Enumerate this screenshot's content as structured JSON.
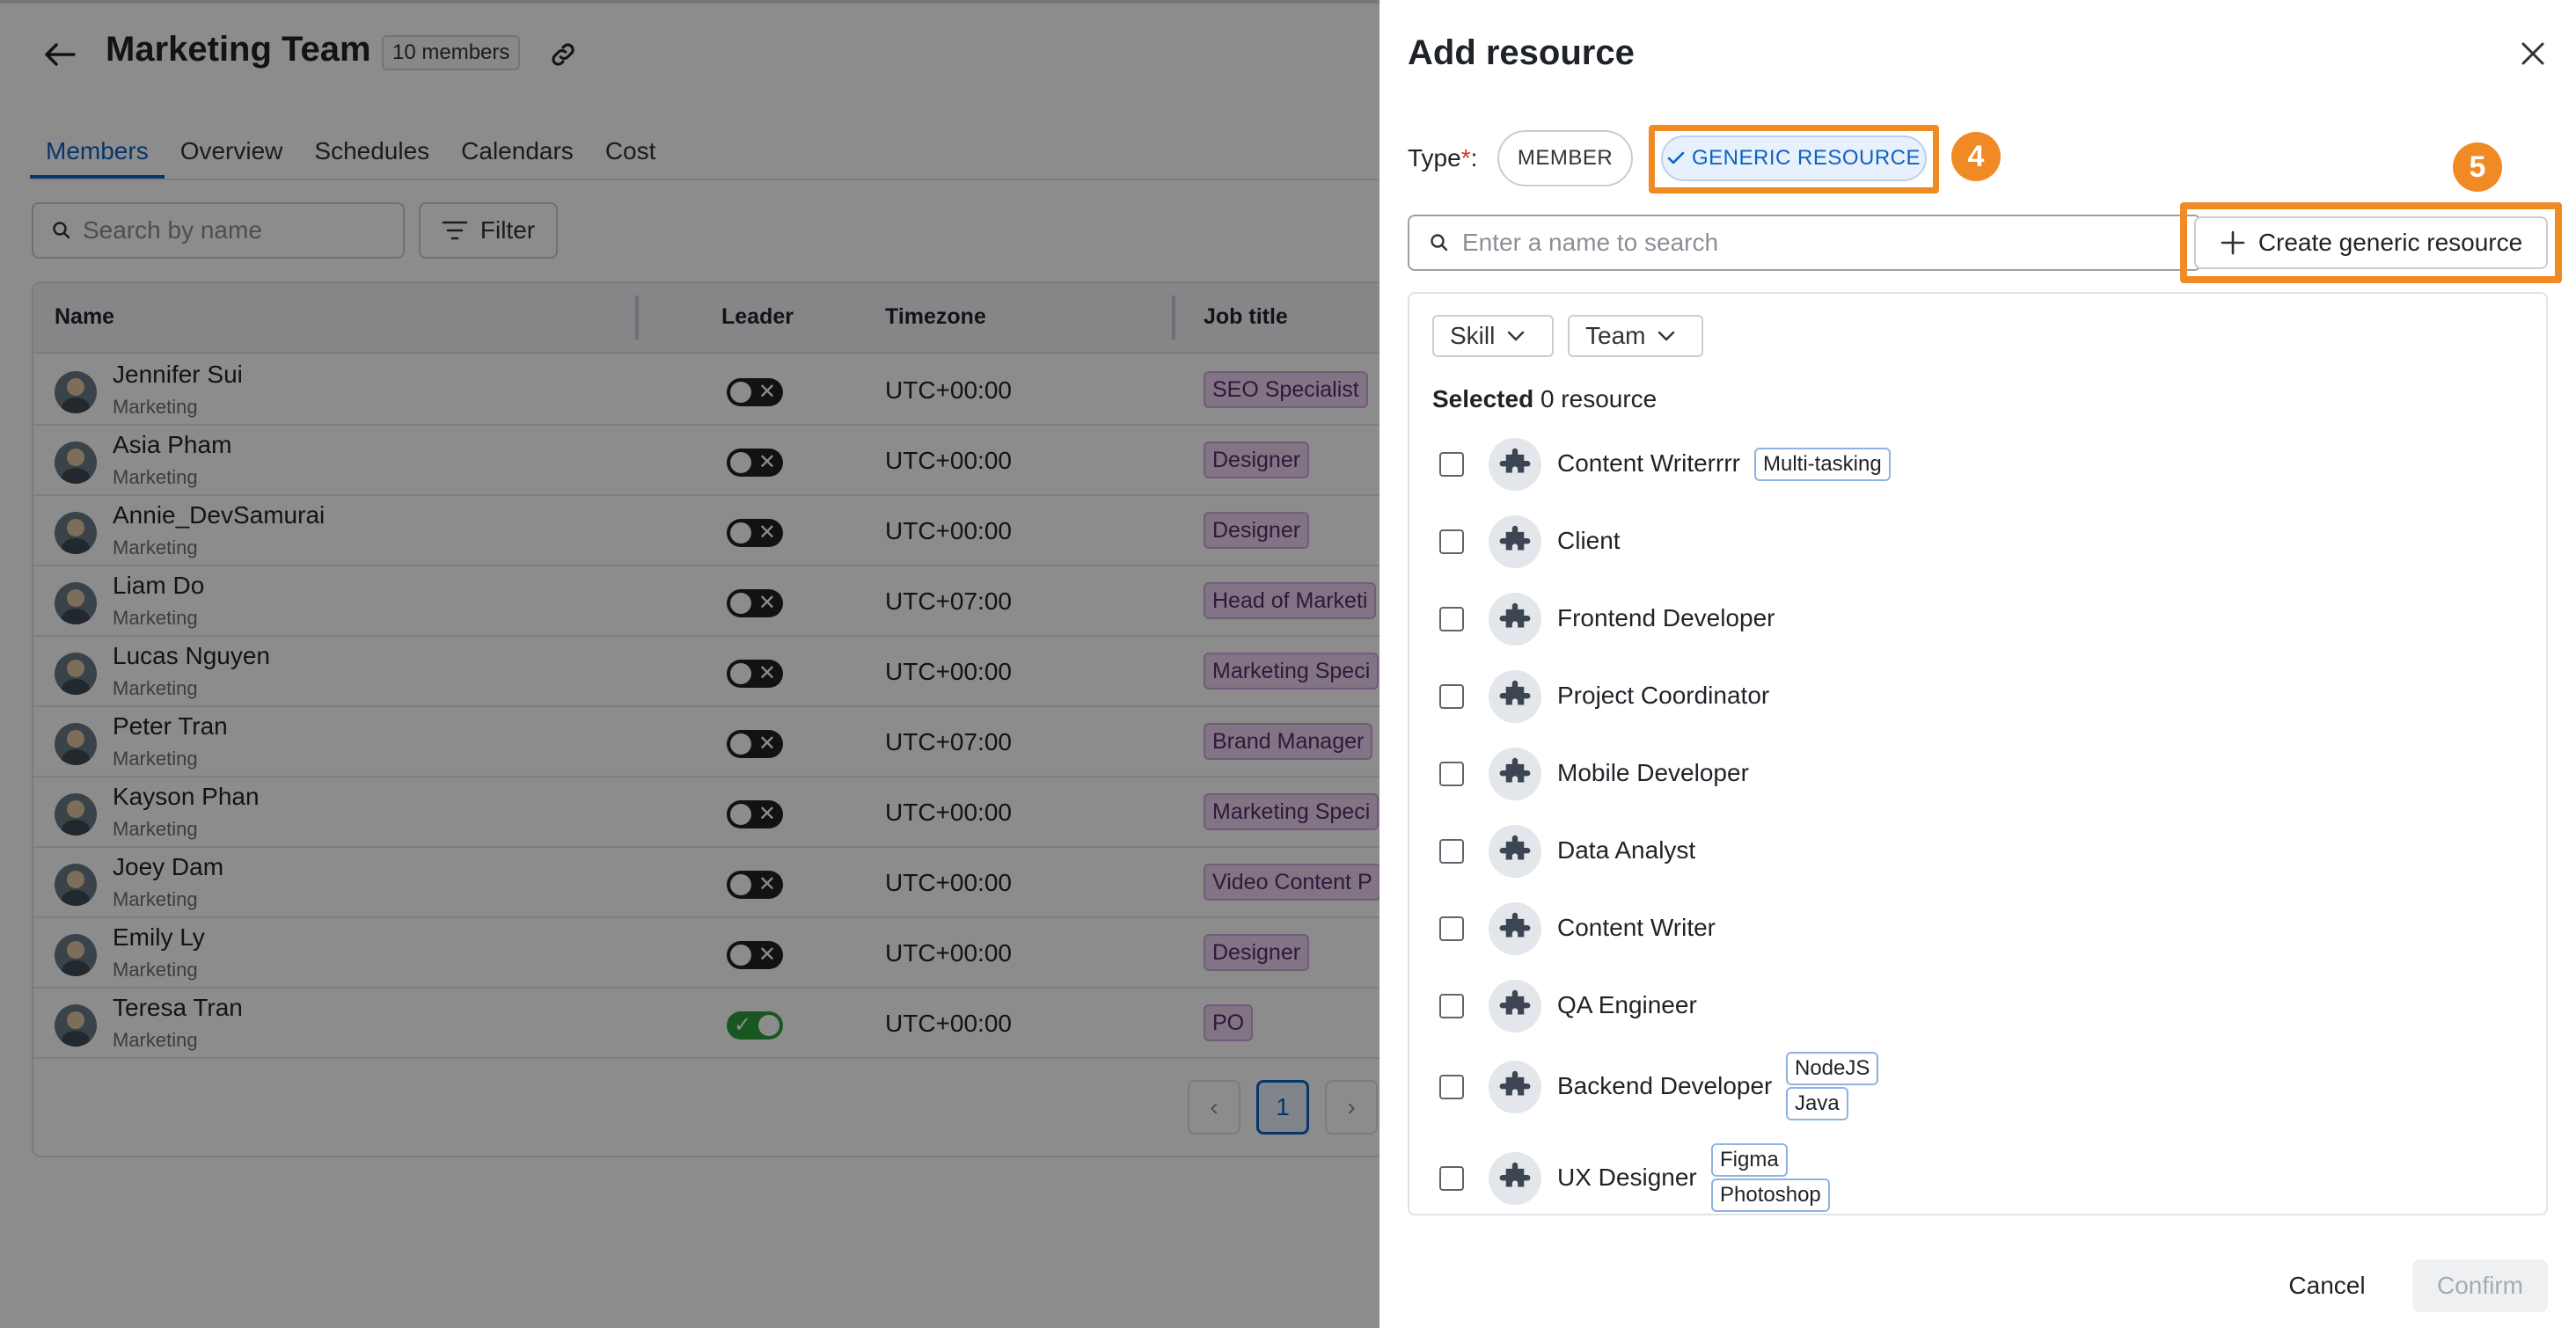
{
  "page": {
    "title": "Marketing Team",
    "members_badge": "10 members",
    "tabs": [
      "Members",
      "Overview",
      "Schedules",
      "Calendars",
      "Cost"
    ],
    "active_tab": "Members",
    "search_placeholder": "Search by name",
    "filter_label": "Filter",
    "columns": [
      "Name",
      "Leader",
      "Timezone",
      "Job title"
    ],
    "members": [
      {
        "name": "Jennifer Sui",
        "dept": "Marketing",
        "leader": false,
        "timezone": "UTC+00:00",
        "job": "SEO Specialist"
      },
      {
        "name": "Asia Pham",
        "dept": "Marketing",
        "leader": false,
        "timezone": "UTC+00:00",
        "job": "Designer"
      },
      {
        "name": "Annie_DevSamurai",
        "dept": "Marketing",
        "leader": false,
        "timezone": "UTC+00:00",
        "job": "Designer"
      },
      {
        "name": "Liam Do",
        "dept": "Marketing",
        "leader": false,
        "timezone": "UTC+07:00",
        "job": "Head of Marketi"
      },
      {
        "name": "Lucas Nguyen",
        "dept": "Marketing",
        "leader": false,
        "timezone": "UTC+00:00",
        "job": "Marketing Speci"
      },
      {
        "name": "Peter Tran",
        "dept": "Marketing",
        "leader": false,
        "timezone": "UTC+07:00",
        "job": "Brand Manager"
      },
      {
        "name": "Kayson Phan",
        "dept": "Marketing",
        "leader": false,
        "timezone": "UTC+00:00",
        "job": "Marketing Speci"
      },
      {
        "name": "Joey Dam",
        "dept": "Marketing",
        "leader": false,
        "timezone": "UTC+00:00",
        "job": "Video Content P"
      },
      {
        "name": "Emily Ly",
        "dept": "Marketing",
        "leader": false,
        "timezone": "UTC+00:00",
        "job": "Designer"
      },
      {
        "name": "Teresa Tran",
        "dept": "Marketing",
        "leader": true,
        "timezone": "UTC+00:00",
        "job": "PO"
      }
    ],
    "pagination": {
      "prev": "‹",
      "current": "1",
      "next": "›"
    }
  },
  "drawer": {
    "title": "Add resource",
    "type_label": "Type",
    "required_mark": "*",
    "type_colon": ":",
    "type_member": "MEMBER",
    "type_generic": "GENERIC RESOURCE",
    "step4": "4",
    "step5": "5",
    "search_placeholder": "Enter a name to search",
    "create_label": "Create generic resource",
    "filter_skill": "Skill",
    "filter_team": "Team",
    "selected_prefix": "Selected",
    "selected_suffix": "0 resource",
    "resources": [
      {
        "name": "Content Writerrrr",
        "tags": [
          "Multi-tasking"
        ]
      },
      {
        "name": "Client",
        "tags": []
      },
      {
        "name": "Frontend Developer",
        "tags": []
      },
      {
        "name": "Project Coordinator",
        "tags": []
      },
      {
        "name": "Mobile Developer",
        "tags": []
      },
      {
        "name": "Data Analyst",
        "tags": []
      },
      {
        "name": "Content Writer",
        "tags": []
      },
      {
        "name": "QA Engineer",
        "tags": []
      },
      {
        "name": "Backend Developer",
        "tags": [
          "NodeJS",
          "Java"
        ]
      },
      {
        "name": "UX Designer",
        "tags": [
          "Figma",
          "Photoshop"
        ]
      }
    ],
    "cancel_label": "Cancel",
    "confirm_label": "Confirm"
  },
  "colors": {
    "accent": "#0b63c5",
    "highlight": "#f08a24",
    "job_tag_bg": "#ecd4f2",
    "overlay": "rgba(0,0,0,0.45)"
  }
}
